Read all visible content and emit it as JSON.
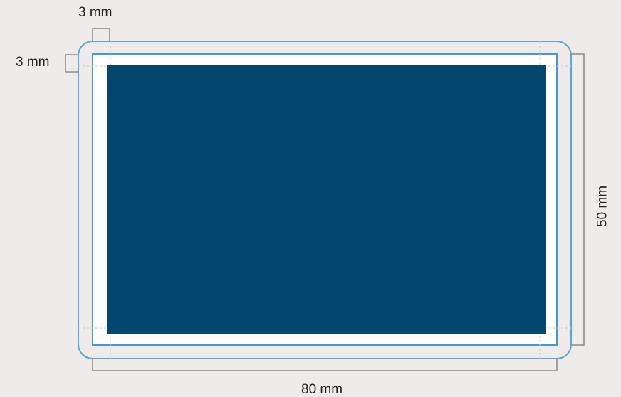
{
  "diagram": {
    "labels": {
      "top_bleed": "3 mm",
      "left_bleed": "3 mm",
      "width": "80 mm",
      "height": "50 mm"
    },
    "colors": {
      "background": "#efebea",
      "bleed_outline": "#5aa4d0",
      "trim_outline": "#4a98c8",
      "safe_area_fill": "#03466e",
      "dimension_lines": "#8a8a8a",
      "guide_lines": "#c8c8d0",
      "card_fill": "#ffffff"
    }
  }
}
